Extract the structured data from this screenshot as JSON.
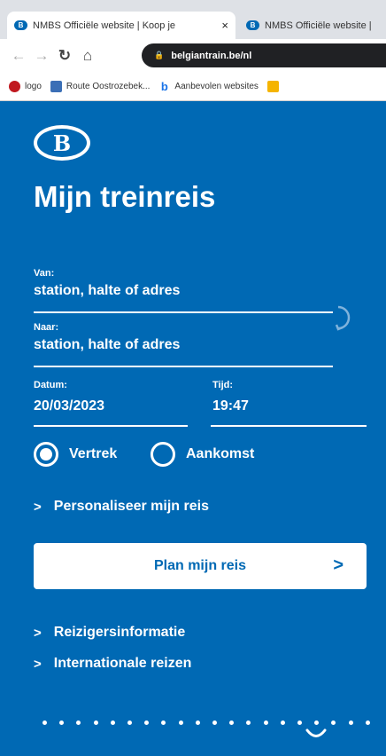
{
  "browser": {
    "tabs": [
      {
        "icon": "nmbs-favicon",
        "title": "NMBS Officiële website | Koop je",
        "close": "×"
      },
      {
        "icon": "nmbs-favicon",
        "title": "NMBS Officiële website |"
      }
    ],
    "favicon_text": "B",
    "address": "belgiantrain.be/nl",
    "lock_symbol": "🔒",
    "bookmarks": [
      {
        "icon": "red-dot-icon",
        "label": "logo",
        "color": "#c0181f"
      },
      {
        "icon": "route-icon",
        "label": "Route Oostrozebek...",
        "color": "#3b6fb6"
      },
      {
        "icon": "bing-icon",
        "label": "Aanbevolen websites",
        "color": "#1a73e8"
      },
      {
        "icon": "folder-icon",
        "label": "",
        "color": "#f5b400"
      }
    ]
  },
  "page": {
    "logo_text": "B",
    "title": "Mijn treinreis",
    "van_label": "Van:",
    "van_placeholder": "station, halte of adres",
    "naar_label": "Naar:",
    "naar_placeholder": "station, halte of adres",
    "datum_label": "Datum:",
    "datum_value": "20/03/2023",
    "tijd_label": "Tijd:",
    "tijd_value": "19:47",
    "radio_vertrek": "Vertrek",
    "radio_aankomst": "Aankomst",
    "selected_radio": "Vertrek",
    "personaliseer": "Personaliseer mijn reis",
    "plan_button": "Plan mijn reis",
    "links": [
      "Reizigersinformatie",
      "Internationale reizen"
    ],
    "chevron": ">",
    "brand_color": "#0069b4"
  }
}
